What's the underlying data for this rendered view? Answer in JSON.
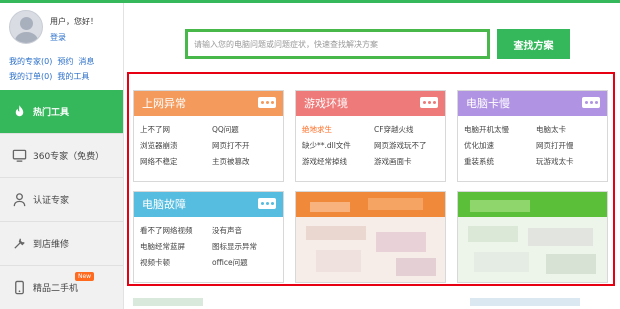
{
  "colors": {
    "accent": "#35b85c",
    "frame": "#e60012"
  },
  "user": {
    "greeting": "用户，您好！",
    "login": "登录",
    "links_row1": [
      "我的专家(0)",
      "预约",
      "消息"
    ],
    "links_row2": [
      "我的订单(0)",
      "我的工具"
    ]
  },
  "sidebar": {
    "items": [
      {
        "label": "热门工具",
        "icon": "fire-icon",
        "active": true
      },
      {
        "label": "360专家（免费）",
        "icon": "expert-icon"
      },
      {
        "label": "认证专家",
        "icon": "person-icon"
      },
      {
        "label": "到店维修",
        "icon": "repair-icon"
      },
      {
        "label": "精品二手机",
        "icon": "phone-icon",
        "badge": "New"
      }
    ]
  },
  "search": {
    "placeholder": "请输入您的电脑问题或问题症状，快速查找解决方案",
    "button": "查找方案"
  },
  "cards": [
    {
      "title": "上网异常",
      "color": "#f39a5c",
      "items": [
        "上不了网",
        "QQ问题",
        "浏览器崩溃",
        "网页打不开",
        "网络不稳定",
        "主页被篡改"
      ]
    },
    {
      "title": "游戏环境",
      "color": "#ee7a7a",
      "items": [
        "绝地求生",
        "CF穿越火线",
        "缺少**.dll文件",
        "网页游戏玩不了",
        "游戏经常掉线",
        "游戏画面卡"
      ],
      "highlight": "绝地求生"
    },
    {
      "title": "电脑卡慢",
      "color": "#b193e4",
      "items": [
        "电脑开机太慢",
        "电脑太卡",
        "优化加速",
        "网页打开慢",
        "重装系统",
        "玩游戏太卡"
      ]
    },
    {
      "title": "电脑故障",
      "color": "#56bde0",
      "items": [
        "看不了网络视频",
        "没有声音",
        "电脑经常蓝屏",
        "图标显示异常",
        "视频卡顿",
        "office问题"
      ]
    }
  ]
}
